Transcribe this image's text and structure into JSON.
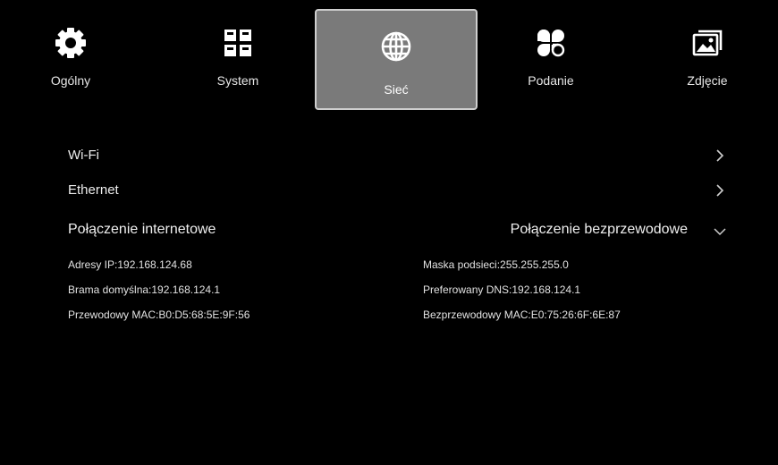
{
  "tabs": [
    {
      "label": "Ogólny",
      "icon": "gear-icon"
    },
    {
      "label": "System",
      "icon": "grid-icon"
    },
    {
      "label": "Sieć",
      "icon": "globe-icon",
      "active": true
    },
    {
      "label": "Podanie",
      "icon": "apps-icon"
    },
    {
      "label": "Zdjęcie",
      "icon": "picture-icon"
    }
  ],
  "menu": {
    "wifi_label": "Wi-Fi",
    "ethernet_label": "Ethernet"
  },
  "connection": {
    "title": "Połączenie internetowe",
    "type_selected": "Połączenie bezprzewodowe"
  },
  "details": {
    "ip": "Adresy IP:192.168.124.68",
    "gateway": "Brama domyślna:192.168.124.1",
    "wired_mac": "Przewodowy MAC:B0:D5:68:5E:9F:56",
    "subnet": "Maska podsieci:255.255.255.0",
    "dns": "Preferowany DNS:192.168.124.1",
    "wireless_mac": "Bezprzewodowy MAC:E0:75:26:6F:6E:87"
  },
  "colors": {
    "background": "#000000",
    "active_tab_bg": "#7a7a7a",
    "text": "#ededed"
  }
}
